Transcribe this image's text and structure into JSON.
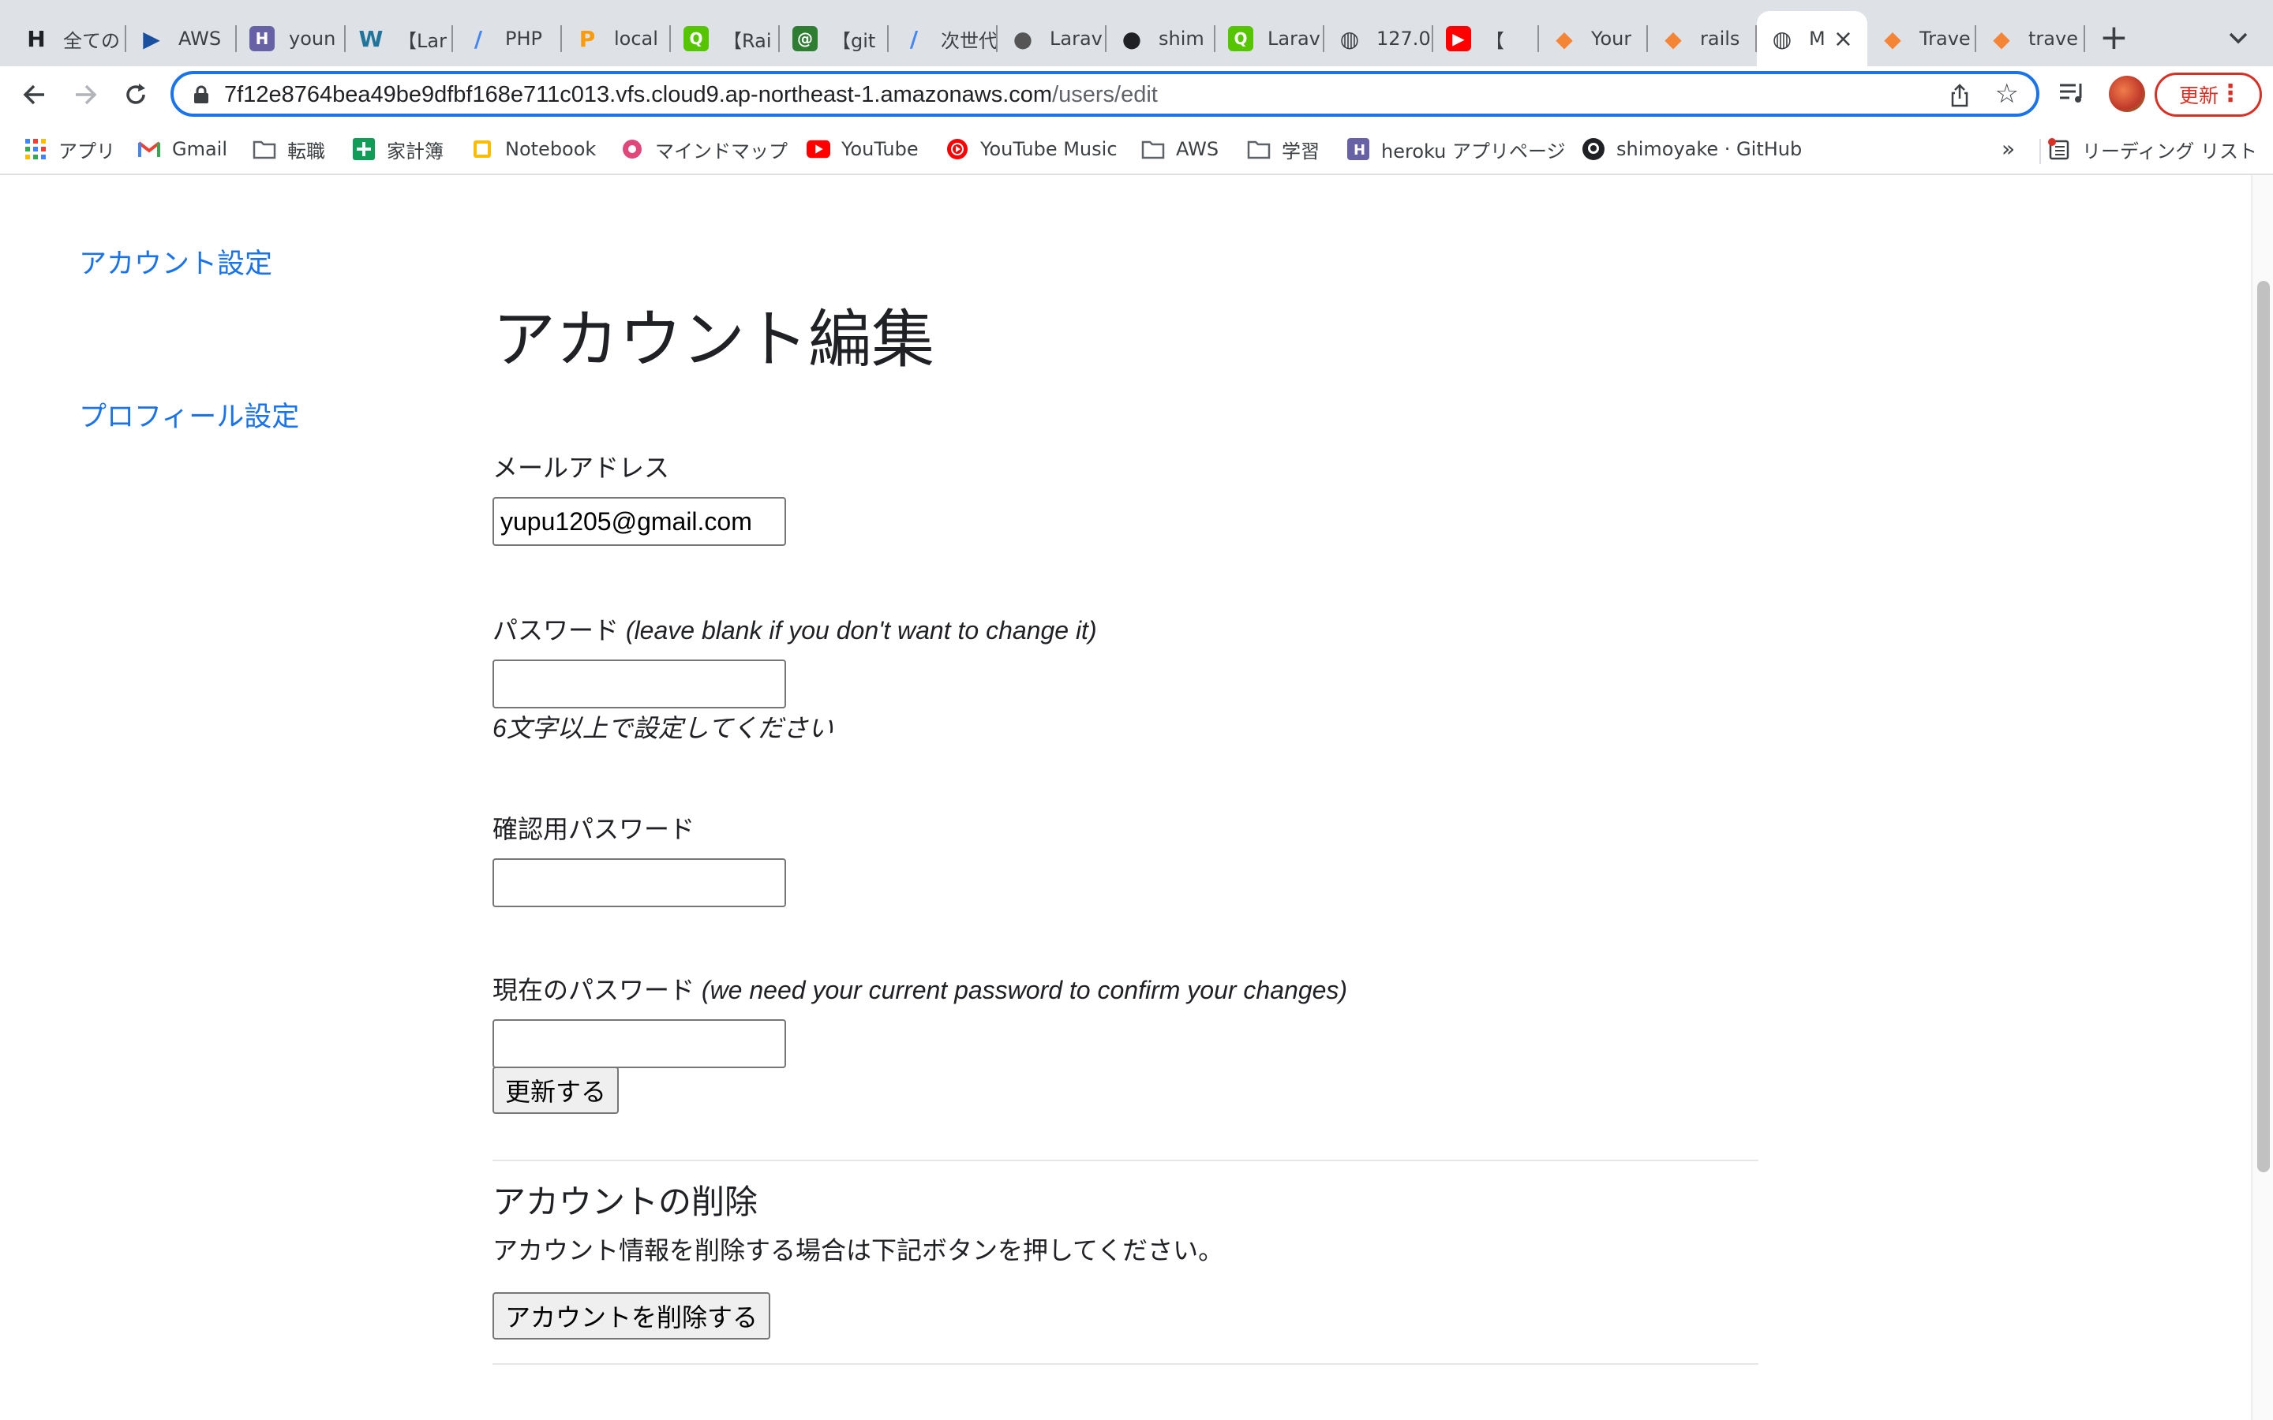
{
  "tabs": [
    {
      "label": "全ての",
      "icon": "H-icon",
      "color": "#202124"
    },
    {
      "label": "AWS",
      "icon": "aws-play-icon",
      "color": "#1a4fa0"
    },
    {
      "label": "youn",
      "icon": "heroku-icon",
      "color": "#6762a6"
    },
    {
      "label": "【Lar",
      "icon": "wordpress-icon",
      "color": "#21759b"
    },
    {
      "label": "PHP",
      "icon": "slash-icon",
      "color": "#4285f4"
    },
    {
      "label": "local",
      "icon": "phpmyadmin-icon",
      "color": "#f89c0e"
    },
    {
      "label": "【Rai",
      "icon": "qiita-icon",
      "color": "#55c500"
    },
    {
      "label": "【git",
      "icon": "at-icon",
      "color": "#2e7d32"
    },
    {
      "label": "次世代",
      "icon": "slash-icon",
      "color": "#4285f4"
    },
    {
      "label": "Larav",
      "icon": "github-octocat-icon",
      "color": "#555555"
    },
    {
      "label": "shim",
      "icon": "github-icon",
      "color": "#202124"
    },
    {
      "label": "Larav",
      "icon": "qiita-icon",
      "color": "#55c500"
    },
    {
      "label": "127.0",
      "icon": "globe-icon",
      "color": "#3c4043"
    },
    {
      "label": "【",
      "icon": "youtube-icon",
      "color": "#ff0000"
    },
    {
      "label": "Your",
      "icon": "aws-cube-icon",
      "color": "#f58536"
    },
    {
      "label": "rails",
      "icon": "aws-cube-icon",
      "color": "#f58536"
    },
    {
      "label": "M",
      "icon": "globe-icon",
      "color": "#3c4043"
    },
    {
      "label": "Trave",
      "icon": "aws-cube-icon",
      "color": "#f58536"
    },
    {
      "label": "trave",
      "icon": "aws-cube-icon",
      "color": "#f58536"
    }
  ],
  "address_bar": {
    "host": "7f12e8764bea49be9dfbf168e711c013.vfs.cloud9.ap-northeast-1.amazonaws.com",
    "path": "/users/edit"
  },
  "update_button": "更新",
  "bookmarks": [
    {
      "label": "アプリ",
      "icon": "apps-grid-icon"
    },
    {
      "label": "Gmail",
      "icon": "gmail-icon"
    },
    {
      "label": "転職",
      "icon": "folder-icon"
    },
    {
      "label": "家計簿",
      "icon": "sheets-plus-icon"
    },
    {
      "label": "Notebook",
      "icon": "notebook-icon"
    },
    {
      "label": "マインドマップ",
      "icon": "mindmap-icon"
    },
    {
      "label": "YouTube",
      "icon": "youtube-icon"
    },
    {
      "label": "YouTube Music",
      "icon": "youtube-music-icon"
    },
    {
      "label": "AWS",
      "icon": "folder-icon"
    },
    {
      "label": "学習",
      "icon": "folder-icon"
    },
    {
      "label": "heroku アプリページ",
      "icon": "heroku-icon"
    },
    {
      "label": "shimoyake · GitHub",
      "icon": "github-icon"
    }
  ],
  "bookmarks_overflow": "»",
  "reading_list": "リーディング リスト",
  "sidebar": {
    "account_settings": "アカウント設定",
    "profile_settings": "プロフィール設定"
  },
  "form": {
    "title": "アカウント編集",
    "email_label": "メールアドレス",
    "email_value": "yupu1205@gmail.com",
    "password_label": "パスワード",
    "password_note": "(leave blank if you don't want to change it)",
    "password_hint": "6文字以上で設定してください",
    "password_confirmation_label": "確認用パスワード",
    "current_password_label": "現在のパスワード",
    "current_password_note": "(we need your current password to confirm your changes)",
    "submit": "更新する"
  },
  "delete_section": {
    "heading": "アカウントの削除",
    "text": "アカウント情報を削除する場合は下記ボタンを押してください。",
    "button": "アカウントを削除する"
  }
}
